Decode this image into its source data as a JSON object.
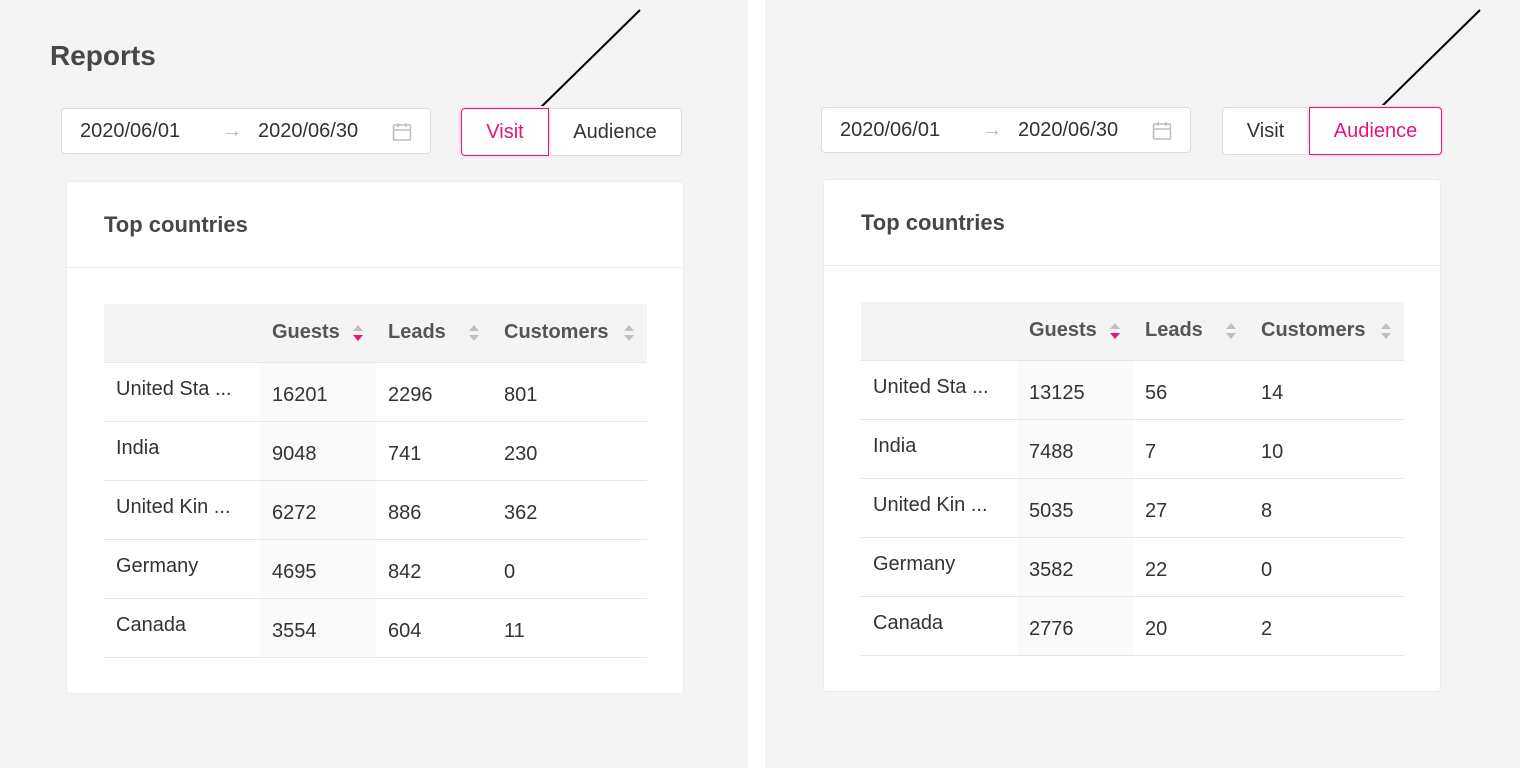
{
  "page_title": "Reports",
  "colors": {
    "accent": "#e5157f",
    "panel_bg": "#f4f4f4",
    "border": "#dcdcdc"
  },
  "icons": {
    "calendar": "calendar-icon",
    "range_arrow": "arrow-right-icon",
    "sort": "sort-caret-icon"
  },
  "panels": [
    {
      "date_range": {
        "start": "2020/06/01",
        "separator": "→",
        "end": "2020/06/30"
      },
      "segments": [
        {
          "label": "Visit",
          "active": true
        },
        {
          "label": "Audience",
          "active": false
        }
      ],
      "card": {
        "title": "Top countries",
        "columns": [
          "",
          "Guests",
          "Leads",
          "Customers"
        ],
        "sorted_column": "Guests",
        "sort_direction": "descending",
        "rows": [
          [
            "United Sta ...",
            "16201",
            "2296",
            "801"
          ],
          [
            "India",
            "9048",
            "741",
            "230"
          ],
          [
            "United Kin ...",
            "6272",
            "886",
            "362"
          ],
          [
            "Germany",
            "4695",
            "842",
            "0"
          ],
          [
            "Canada",
            "3554",
            "604",
            "11"
          ]
        ]
      }
    },
    {
      "date_range": {
        "start": "2020/06/01",
        "separator": "→",
        "end": "2020/06/30"
      },
      "segments": [
        {
          "label": "Visit",
          "active": false
        },
        {
          "label": "Audience",
          "active": true
        }
      ],
      "card": {
        "title": "Top countries",
        "columns": [
          "",
          "Guests",
          "Leads",
          "Customers"
        ],
        "sorted_column": "Guests",
        "sort_direction": "descending",
        "rows": [
          [
            "United Sta ...",
            "13125",
            "56",
            "14"
          ],
          [
            "India",
            "7488",
            "7",
            "10"
          ],
          [
            "United Kin ...",
            "5035",
            "27",
            "8"
          ],
          [
            "Germany",
            "3582",
            "22",
            "0"
          ],
          [
            "Canada",
            "2776",
            "20",
            "2"
          ]
        ]
      }
    }
  ]
}
